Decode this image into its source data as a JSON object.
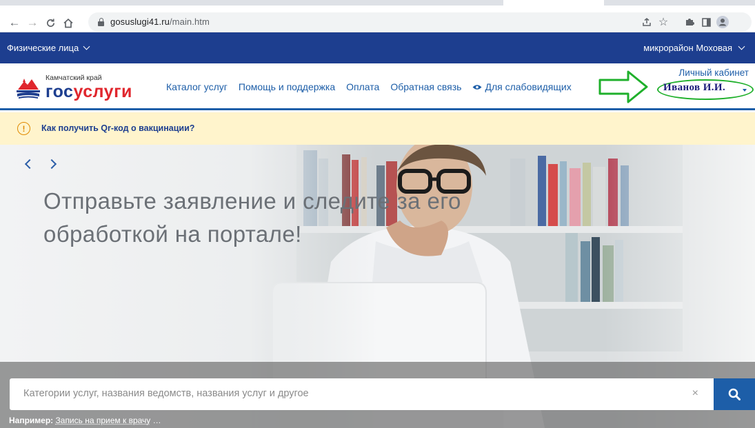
{
  "browser": {
    "url_domain": "gosuslugi41.ru",
    "url_path": "/main.htm",
    "back_icon": "←",
    "forward_icon": "→",
    "reload_icon": "C",
    "home_icon": "⌂",
    "share_icon": "⇪",
    "star_icon": "☆",
    "extensions_icon": "✱",
    "sidepanel_icon": "▢",
    "profile_icon": "person"
  },
  "topbar": {
    "audience_label": "Физические лица",
    "location_label": "микрорайон Моховая"
  },
  "header": {
    "region": "Камчатский край",
    "logo_part1": "гос",
    "logo_part2": "услуги",
    "nav": [
      {
        "label": "Каталог услуг"
      },
      {
        "label": "Помощь и поддержка"
      },
      {
        "label": "Оплата"
      },
      {
        "label": "Обратная связь"
      },
      {
        "label": "Для слабовидящих"
      }
    ],
    "cabinet_label": "Личный кабинет",
    "user_name": "Иванов И.И."
  },
  "notice": {
    "icon": "!",
    "text": "Как получить Qr-код о вакцинации?"
  },
  "hero": {
    "headline": "Отправьте заявление и следите за его обработкой на портале!",
    "search_placeholder": "Категории услуг, названия ведомств, названия услуг и другое",
    "clear_icon": "×",
    "example_label": "Например:",
    "example_link": "Запись на прием к врачу",
    "example_more": "…"
  },
  "colors": {
    "brand_blue": "#1d3e8f",
    "link_blue": "#1d5ea8",
    "brand_red": "#e0262d",
    "notice_bg": "#fff4cc",
    "annotation_green": "#1fb02b"
  }
}
